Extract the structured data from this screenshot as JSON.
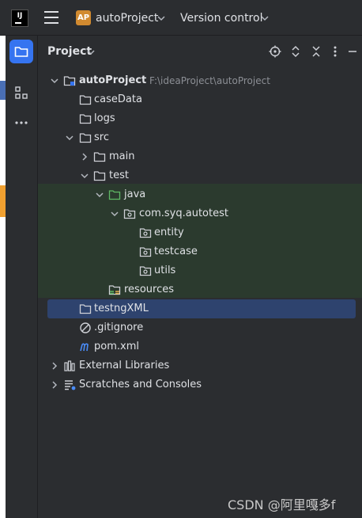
{
  "titlebar": {
    "app_logo_text": "IJ",
    "project_badge": "AP",
    "project_name": "autoProject",
    "version_control": "Version control"
  },
  "panel": {
    "title": "Project"
  },
  "tree": [
    {
      "label": "autoProject",
      "path": "F:\\ideaProject\\autoProject",
      "icon": "module-folder-icon",
      "expander": "expanded"
    },
    {
      "label": "caseData",
      "icon": "folder-icon",
      "expander": "none"
    },
    {
      "label": "logs",
      "icon": "folder-icon",
      "expander": "none"
    },
    {
      "label": "src",
      "icon": "folder-icon",
      "expander": "expanded"
    },
    {
      "label": "main",
      "icon": "folder-icon",
      "expander": "collapsed"
    },
    {
      "label": "test",
      "icon": "folder-icon",
      "expander": "expanded"
    },
    {
      "label": "java",
      "icon": "test-source-folder-icon",
      "expander": "expanded"
    },
    {
      "label": "com.syq.autotest",
      "icon": "package-icon",
      "expander": "expanded"
    },
    {
      "label": "entity",
      "icon": "package-icon",
      "expander": "none"
    },
    {
      "label": "testcase",
      "icon": "package-icon",
      "expander": "none"
    },
    {
      "label": "utils",
      "icon": "package-icon",
      "expander": "none"
    },
    {
      "label": "resources",
      "icon": "test-resources-folder-icon",
      "expander": "none"
    },
    {
      "label": "testngXML",
      "icon": "folder-icon",
      "expander": "none",
      "selected": true
    },
    {
      "label": ".gitignore",
      "icon": "ignored-file-icon",
      "expander": "none"
    },
    {
      "label": "pom.xml",
      "icon": "maven-icon",
      "expander": "none"
    },
    {
      "label": "External Libraries",
      "icon": "libraries-icon",
      "expander": "collapsed"
    },
    {
      "label": "Scratches and Consoles",
      "icon": "scratches-icon",
      "expander": "collapsed"
    }
  ],
  "watermark": "CSDN @阿里嘎多f",
  "colors": {
    "background": "#2b2d30",
    "selection": "#2e436e",
    "test_band": "#2b3a2e",
    "accent": "#3574f0",
    "badge": "#d18a30"
  }
}
